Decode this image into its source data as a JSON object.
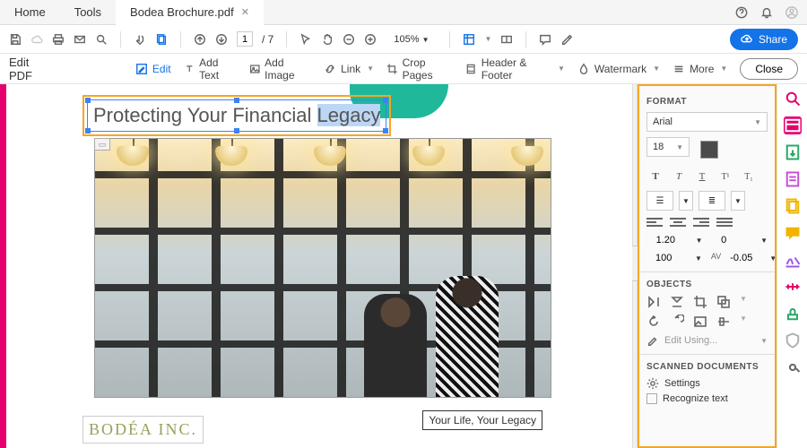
{
  "tabs": {
    "home": "Home",
    "tools": "Tools",
    "file": "Bodea Brochure.pdf"
  },
  "toolbar": {
    "page_current": "1",
    "page_total": "7",
    "zoom": "105%",
    "share": "Share"
  },
  "editbar": {
    "title": "Edit PDF",
    "edit": "Edit",
    "addtext": "Add Text",
    "addimage": "Add Image",
    "link": "Link",
    "crop": "Crop Pages",
    "header": "Header & Footer",
    "watermark": "Watermark",
    "more": "More",
    "close": "Close"
  },
  "doc": {
    "title_prefix": "Protecting Your Financial ",
    "title_sel": "Legacy",
    "logo": "BODÉA INC.",
    "tagline": "Your Life, Your Legacy"
  },
  "format": {
    "header": "FORMAT",
    "font": "Arial",
    "size": "18",
    "line": "1.20",
    "indent": "0",
    "hscale": "100",
    "tracking": "-0.05"
  },
  "objects": {
    "header": "OBJECTS",
    "editusing": "Edit Using..."
  },
  "scanned": {
    "header": "SCANNED DOCUMENTS",
    "settings": "Settings",
    "recognize": "Recognize text"
  }
}
